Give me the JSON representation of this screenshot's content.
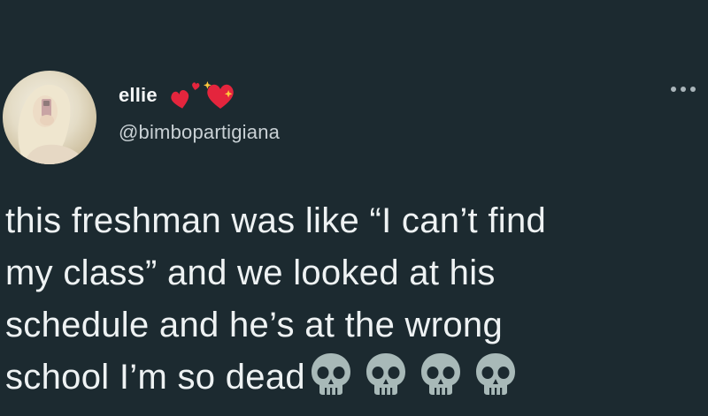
{
  "user": {
    "display_name": "ellie",
    "handle": "@bimbopartigiana",
    "name_emoji": "heart-icon, sparkling-heart-icon",
    "avatar": "profile-photo"
  },
  "tweet": {
    "lines": [
      "this freshman was like “I can’t find",
      "my class” and we looked at his",
      "schedule and he’s at the wrong",
      "school I’m so dead"
    ],
    "trailing_emoji": [
      "skull-icon",
      "skull-icon",
      "skull-icon",
      "skull-icon"
    ]
  },
  "menu": {
    "icon": "more-options-icon"
  },
  "colors": {
    "background": "#1c2a30",
    "text": "#eef2f3",
    "handle": "#c9d1d5",
    "heart": "#e4253d",
    "skull": "#a8b9b8"
  }
}
